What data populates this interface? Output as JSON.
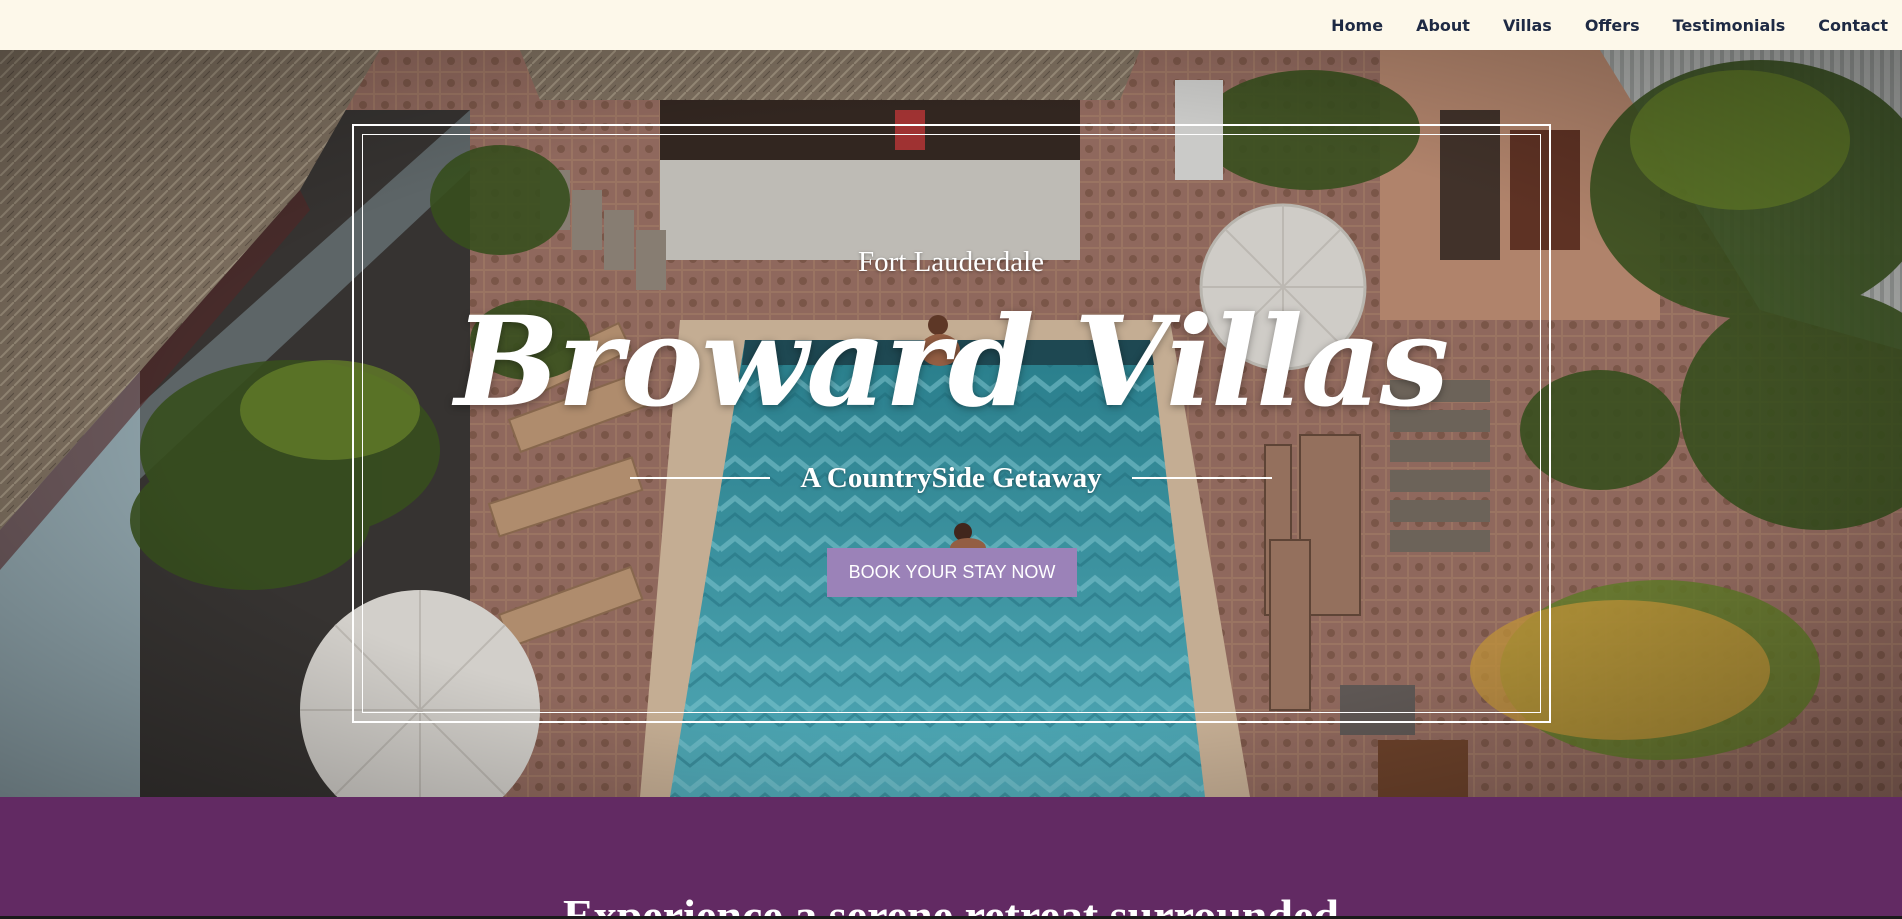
{
  "nav": {
    "items": [
      "Home",
      "About",
      "Villas",
      "Offers",
      "Testimonials",
      "Contact"
    ]
  },
  "hero": {
    "location": "Fort Lauderdale",
    "title": "Broward Villas",
    "tagline": "A CountrySide Getaway",
    "cta_label": "BOOK YOUR STAY NOW"
  },
  "intro": {
    "text": "Experience a serene retreat surrounded"
  },
  "colors": {
    "nav_bg": "#fdf8ea",
    "nav_text": "#1e2a44",
    "cta_bg": "#9b82b8",
    "section_bg": "#622a63"
  }
}
